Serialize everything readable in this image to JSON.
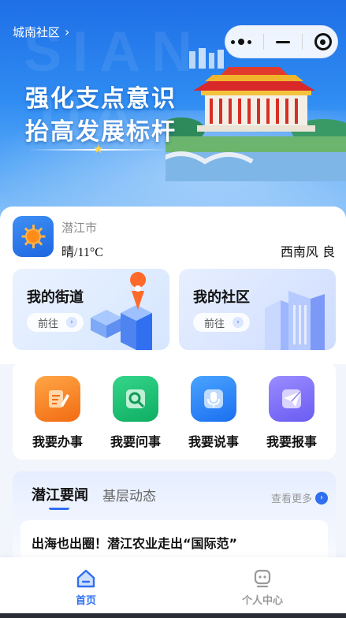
{
  "header": {
    "location": "城南社区",
    "slogan_line1": "强化支点意识",
    "slogan_line2": "抬高发展标杆",
    "watermark": "SIAN JIA"
  },
  "weather": {
    "city": "潜江市",
    "condition": "晴/11°C",
    "wind_quality": "西南风 良",
    "icon": "sun-icon"
  },
  "cards": {
    "street": {
      "title": "我的街道",
      "action": "前往"
    },
    "community": {
      "title": "我的社区",
      "action": "前往"
    }
  },
  "services": [
    {
      "label": "我要办事",
      "icon": "task-edit-icon",
      "color": "#f26b12"
    },
    {
      "label": "我要问事",
      "icon": "search-icon",
      "color": "#0fae62"
    },
    {
      "label": "我要说事",
      "icon": "microphone-icon",
      "color": "#1b6ff0"
    },
    {
      "label": "我要报事",
      "icon": "send-plane-icon",
      "color": "#6a5cf2"
    }
  ],
  "news": {
    "tab_active": "潜江要闻",
    "tab_other": "基层动态",
    "more": "查看更多",
    "items": [
      {
        "headline": "出海也出圈！潜江农业走出“国际范”"
      }
    ]
  },
  "tabbar": {
    "home": "首页",
    "profile": "个人中心"
  },
  "colors": {
    "accent": "#2f6ff0",
    "banner": "#1f6fe6"
  }
}
